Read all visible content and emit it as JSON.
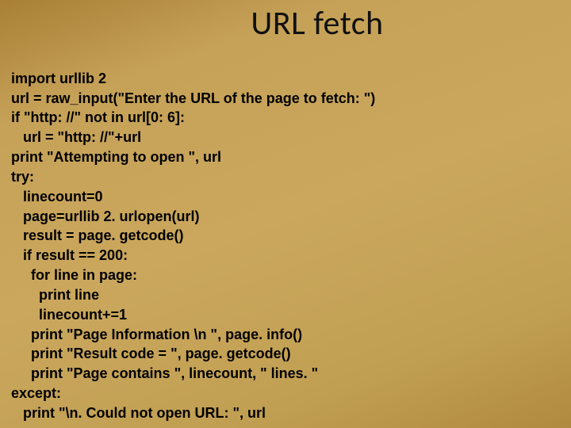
{
  "title": "URL fetch",
  "code": {
    "l1": "import urllib 2",
    "l2": "url = raw_input(\"Enter the URL of the page to fetch: \")",
    "l3": "if \"http: //\" not in url[0: 6]:",
    "l4": "   url = \"http: //\"+url",
    "l5": "print \"Attempting to open \", url",
    "l6": "try:",
    "l7": "   linecount=0",
    "l8": "   page=urllib 2. urlopen(url)",
    "l9": "   result = page. getcode()",
    "l10": "   if result == 200:",
    "l11": "     for line in page:",
    "l12": "       print line",
    "l13": "       linecount+=1",
    "l14": "     print \"Page Information \\n \", page. info()",
    "l15": "     print \"Result code = \", page. getcode()",
    "l16": "     print \"Page contains \", linecount, \" lines. \"",
    "l17": "except:",
    "l18": "   print \"\\n. Could not open URL: \", url"
  }
}
